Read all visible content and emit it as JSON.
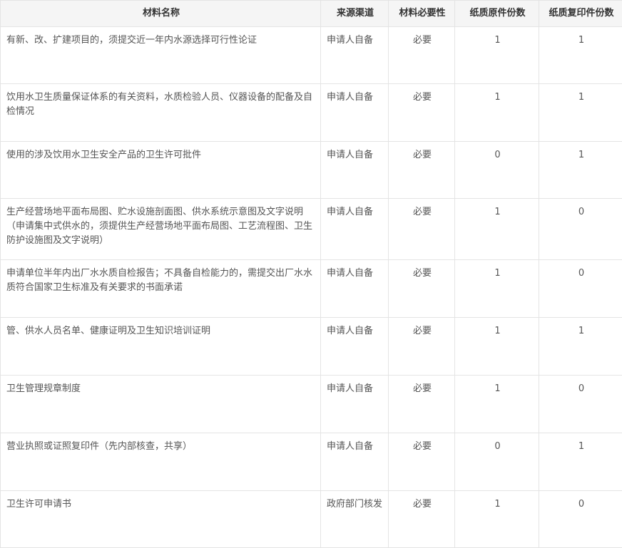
{
  "table": {
    "headers": {
      "name": "材料名称",
      "source": "来源渠道",
      "required": "材料必要性",
      "original": "纸质原件份数",
      "copy": "纸质复印件份数"
    },
    "rows": [
      {
        "name": "有新、改、扩建项目的，须提交近一年内水源选择可行性论证",
        "source": "申请人自备",
        "required": "必要",
        "original": "1",
        "copy": "1"
      },
      {
        "name": "饮用水卫生质量保证体系的有关资料，水质检验人员、仪器设备的配备及自检情况",
        "source": "申请人自备",
        "required": "必要",
        "original": "1",
        "copy": "1"
      },
      {
        "name": "使用的涉及饮用水卫生安全产品的卫生许可批件",
        "source": "申请人自备",
        "required": "必要",
        "original": "0",
        "copy": "1"
      },
      {
        "name": "生产经营场地平面布局图、贮水设施剖面图、供水系统示意图及文字说明（申请集中式供水的，须提供生产经营场地平面布局图、工艺流程图、卫生防护设施图及文字说明）",
        "source": "申请人自备",
        "required": "必要",
        "original": "1",
        "copy": "0"
      },
      {
        "name": "申请单位半年内出厂水水质自检报告；不具备自检能力的，需提交出厂水水质符合国家卫生标准及有关要求的书面承诺",
        "source": "申请人自备",
        "required": "必要",
        "original": "1",
        "copy": "0"
      },
      {
        "name": "管、供水人员名单、健康证明及卫生知识培训证明",
        "source": "申请人自备",
        "required": "必要",
        "original": "1",
        "copy": "1"
      },
      {
        "name": "卫生管理规章制度",
        "source": "申请人自备",
        "required": "必要",
        "original": "1",
        "copy": "0"
      },
      {
        "name": "营业执照或证照复印件（先内部核查，共享）",
        "source": "申请人自备",
        "required": "必要",
        "original": "0",
        "copy": "1"
      },
      {
        "name": "卫生许可申请书",
        "source": "政府部门核发",
        "required": "必要",
        "original": "1",
        "copy": "0"
      }
    ]
  }
}
